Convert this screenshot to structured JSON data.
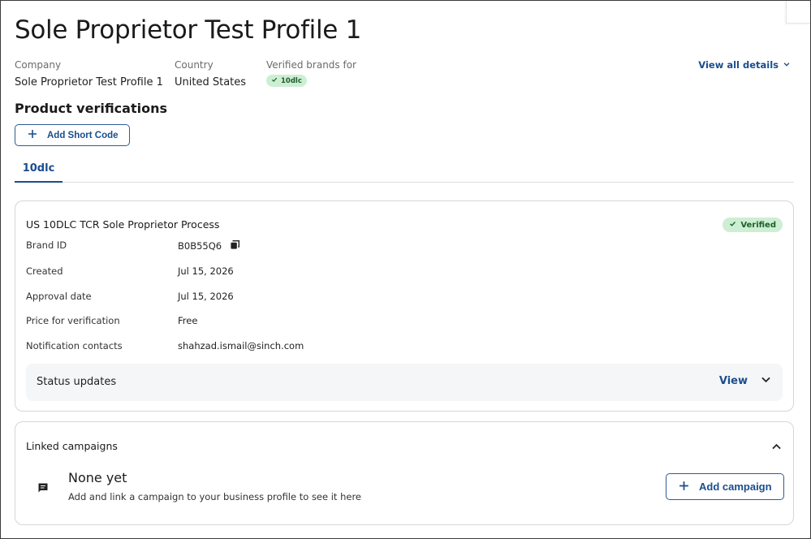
{
  "page": {
    "title": "Sole Proprietor Test Profile 1"
  },
  "meta": {
    "company_label": "Company",
    "company_value": "Sole Proprietor Test Profile 1",
    "country_label": "Country",
    "country_value": "United States",
    "verified_label": "Verified brands for",
    "verified_chip": "10dlc",
    "view_all": "View all details"
  },
  "product_verifications": {
    "title": "Product verifications",
    "add_short_code": "Add Short Code"
  },
  "tabs": [
    {
      "label": "10dlc",
      "active": true
    }
  ],
  "process": {
    "title": "US 10DLC TCR Sole Proprietor Process",
    "badge": "Verified",
    "rows": [
      {
        "label": "Brand ID",
        "value": "B0B55Q6"
      },
      {
        "label": "Created",
        "value": "Jul 15, 2026"
      },
      {
        "label": "Approval date",
        "value": "Jul 15, 2026"
      },
      {
        "label": "Price for verification",
        "value": "Free"
      },
      {
        "label": "Notification contacts",
        "value": "shahzad.ismail@sinch.com"
      }
    ],
    "status_updates": {
      "label": "Status updates",
      "view": "View"
    }
  },
  "linked_campaigns": {
    "title": "Linked campaigns",
    "empty_title": "None yet",
    "empty_subtitle": "Add and link a campaign to your business profile to see it here",
    "add_button": "Add campaign"
  },
  "colors": {
    "accent": "#1a4d8c",
    "verified_bg": "#cdeed2",
    "verified_text": "#1d5e2a",
    "panel_bg": "#f5f6f7"
  },
  "icons": {
    "check": "check-icon",
    "chevron_down": "chevron-down-icon",
    "chevron_up": "chevron-up-icon",
    "plus": "plus-icon",
    "copy": "copy-icon",
    "message": "message-icon"
  }
}
